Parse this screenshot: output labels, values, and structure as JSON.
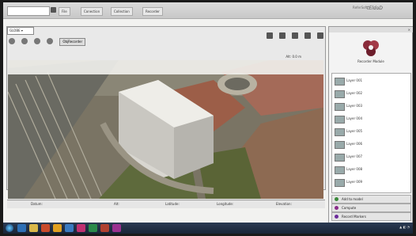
{
  "topbar": {
    "search_placeholder": "",
    "menus": [
      "File",
      "Conection",
      "Collection",
      "Recorder"
    ],
    "brand_small": "ReferSoft",
    "brand_logo": "tEldoD"
  },
  "viewer": {
    "tab": "GLOBE ▾",
    "toolbar_label": "ObjRecorder",
    "status_text": "Alt: 0.0 m",
    "bottom": [
      "Datum:",
      "Alt:",
      "Latitude:",
      "Longitude:",
      "Elevation:"
    ]
  },
  "panel": {
    "header": "",
    "logo_label": "Recorder Module",
    "items": [
      "Layer 001",
      "Layer 002",
      "Layer 003",
      "Layer 004",
      "Layer 005",
      "Layer 006",
      "Layer 007",
      "Layer 008",
      "Layer 009"
    ],
    "actions": [
      "Add to model",
      "Compute",
      "Record Markers"
    ]
  },
  "colors": {
    "taskbar": "#1a2538",
    "accent_red": "#8a2a3a"
  }
}
